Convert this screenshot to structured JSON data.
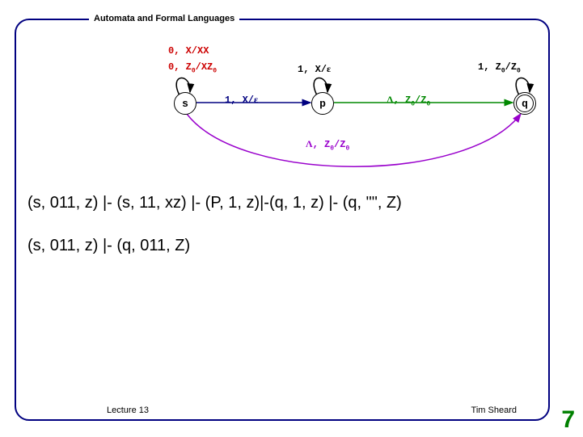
{
  "header": {
    "title": "Automata and Formal Languages"
  },
  "footer": {
    "left": "Lecture 13",
    "right": "Tim Sheard",
    "page_number": "7"
  },
  "states": {
    "s": "s",
    "p": "p",
    "q": "q"
  },
  "labels": {
    "l1": "0, X/XX",
    "l2_a": "0, Z",
    "l2_b": "/XZ",
    "l3_a": "1, X/",
    "l4_a": "1, X/",
    "l5_a": "1, Z",
    "l5_b": "/Z",
    "l6_sym": "Λ",
    "l6_a": ", Z",
    "l6_b": "/Z",
    "l7_sym": "Λ",
    "l7_a": ", Z",
    "l7_b": "/Z",
    "sub0": "0",
    "eps": "ε"
  },
  "derivations": {
    "line1": "(s, 011, z) |- (s, 11, xz) |- (P, 1, z)|-(q, 1, z) |- (q, \"\", Z)",
    "line2": "(s, 011, z) |- (q, 011, Z)"
  },
  "chart_data": {
    "type": "pda_transition_diagram",
    "states": [
      "s",
      "p",
      "q"
    ],
    "start_state": "s",
    "accepting_states": [
      "q"
    ],
    "transitions": [
      {
        "from": "s",
        "to": "s",
        "label": "0, X/XX"
      },
      {
        "from": "s",
        "to": "s",
        "label": "0, Z0/XZ0"
      },
      {
        "from": "s",
        "to": "p",
        "label": "1, X/ε"
      },
      {
        "from": "p",
        "to": "p",
        "label": "1, X/ε"
      },
      {
        "from": "p",
        "to": "q",
        "label": "Λ, Z0/Z0"
      },
      {
        "from": "q",
        "to": "q",
        "label": "1, Z0/Z0"
      },
      {
        "from": "s",
        "to": "q",
        "label": "Λ, Z0/Z0"
      }
    ]
  }
}
